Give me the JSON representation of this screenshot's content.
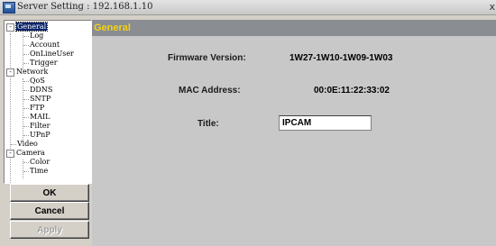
{
  "window": {
    "title": "Server Setting : 192.168.1.10",
    "close_glyph": "x"
  },
  "tree": {
    "expander_glyph": "-",
    "general": {
      "label": "General",
      "children": [
        "Log",
        "Account",
        "OnLineUser",
        "Trigger"
      ]
    },
    "network": {
      "label": "Network",
      "children": [
        "QoS",
        "DDNS",
        "SNTP",
        "FTP",
        "MAIL",
        "Filter",
        "UPnP"
      ]
    },
    "video": {
      "label": "Video"
    },
    "camera": {
      "label": "Camera",
      "children": [
        "Color",
        "Time"
      ]
    },
    "selected": "General"
  },
  "buttons": {
    "ok": "OK",
    "cancel": "Cancel",
    "apply": "Apply",
    "apply_enabled": false
  },
  "panel": {
    "header": "General",
    "header_color": "#f3d11a",
    "firmware_label": "Firmware Version:",
    "firmware_value": "1W27-1W10-1W09-1W03",
    "mac_label": "MAC Address:",
    "mac_value": "00:0E:11:22:33:02",
    "title_label": "Title:",
    "title_value": "IPCAM"
  }
}
